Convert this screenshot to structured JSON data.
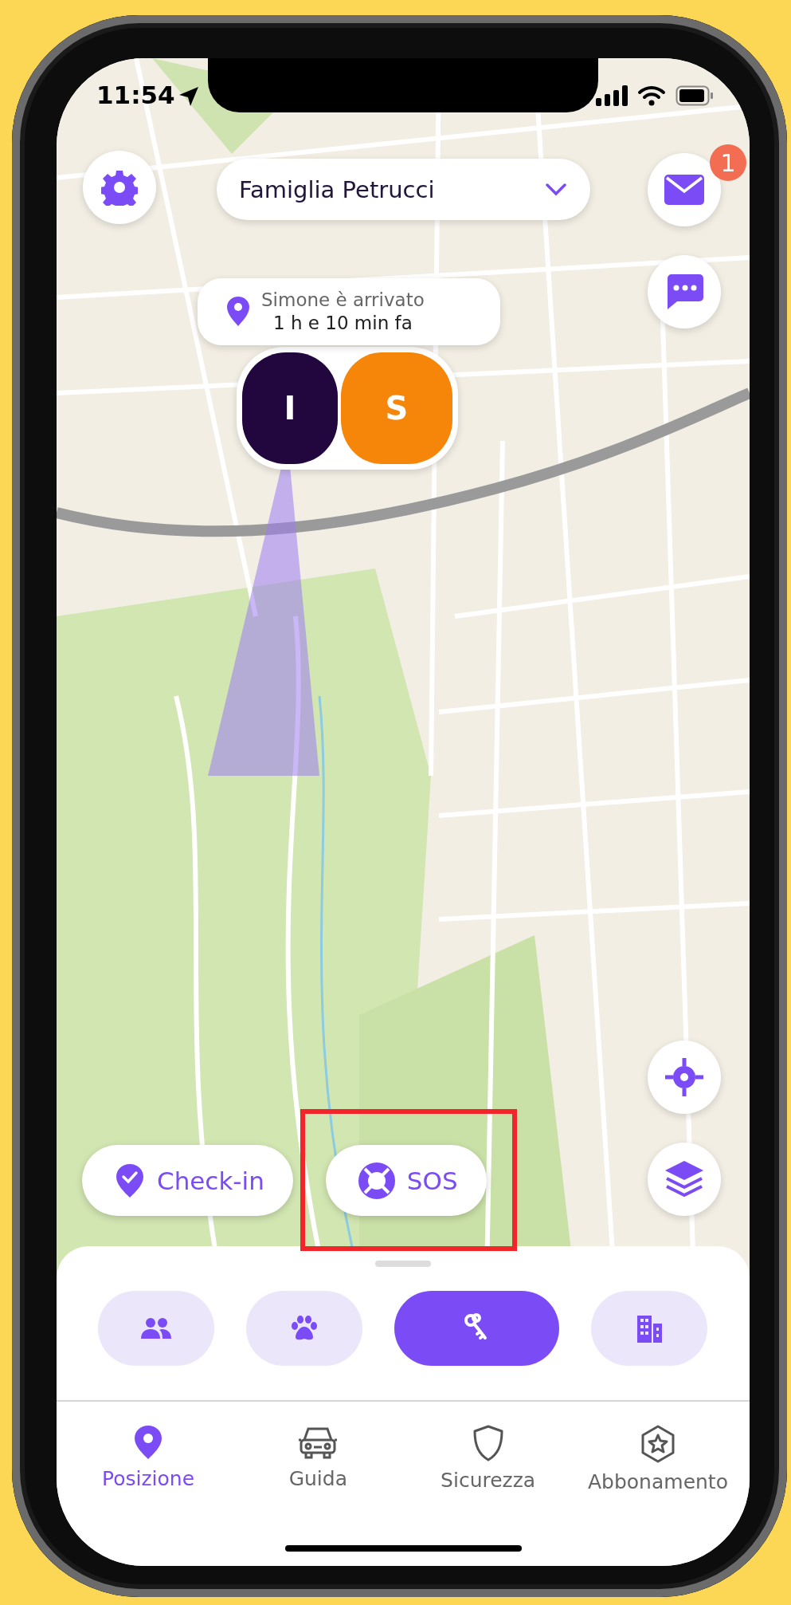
{
  "status_bar": {
    "time": "11:54"
  },
  "group_selector": {
    "label": "Famiglia Petrucci"
  },
  "notifications": {
    "badge": "1"
  },
  "arrival_notice": {
    "title": "Simone è arrivato",
    "time": "1 h e 10 min fa"
  },
  "members": [
    {
      "initial": "I",
      "color": "#22073f"
    },
    {
      "initial": "S",
      "color": "#f5860a"
    }
  ],
  "actions": [
    {
      "label": "Check-in",
      "kind": "checkin",
      "highlighted": false
    },
    {
      "label": "SOS",
      "kind": "sos",
      "highlighted": true
    }
  ],
  "categories": [
    {
      "kind": "people",
      "selected": false
    },
    {
      "kind": "pets",
      "selected": false
    },
    {
      "kind": "keys",
      "selected": true
    },
    {
      "kind": "buildings",
      "selected": false
    }
  ],
  "tabs": [
    {
      "label": "Posizione",
      "kind": "location",
      "selected": true
    },
    {
      "label": "Guida",
      "kind": "car",
      "selected": false
    },
    {
      "label": "Sicurezza",
      "kind": "shield",
      "selected": false
    },
    {
      "label": "Abbonamento",
      "kind": "subscription",
      "selected": false
    }
  ]
}
